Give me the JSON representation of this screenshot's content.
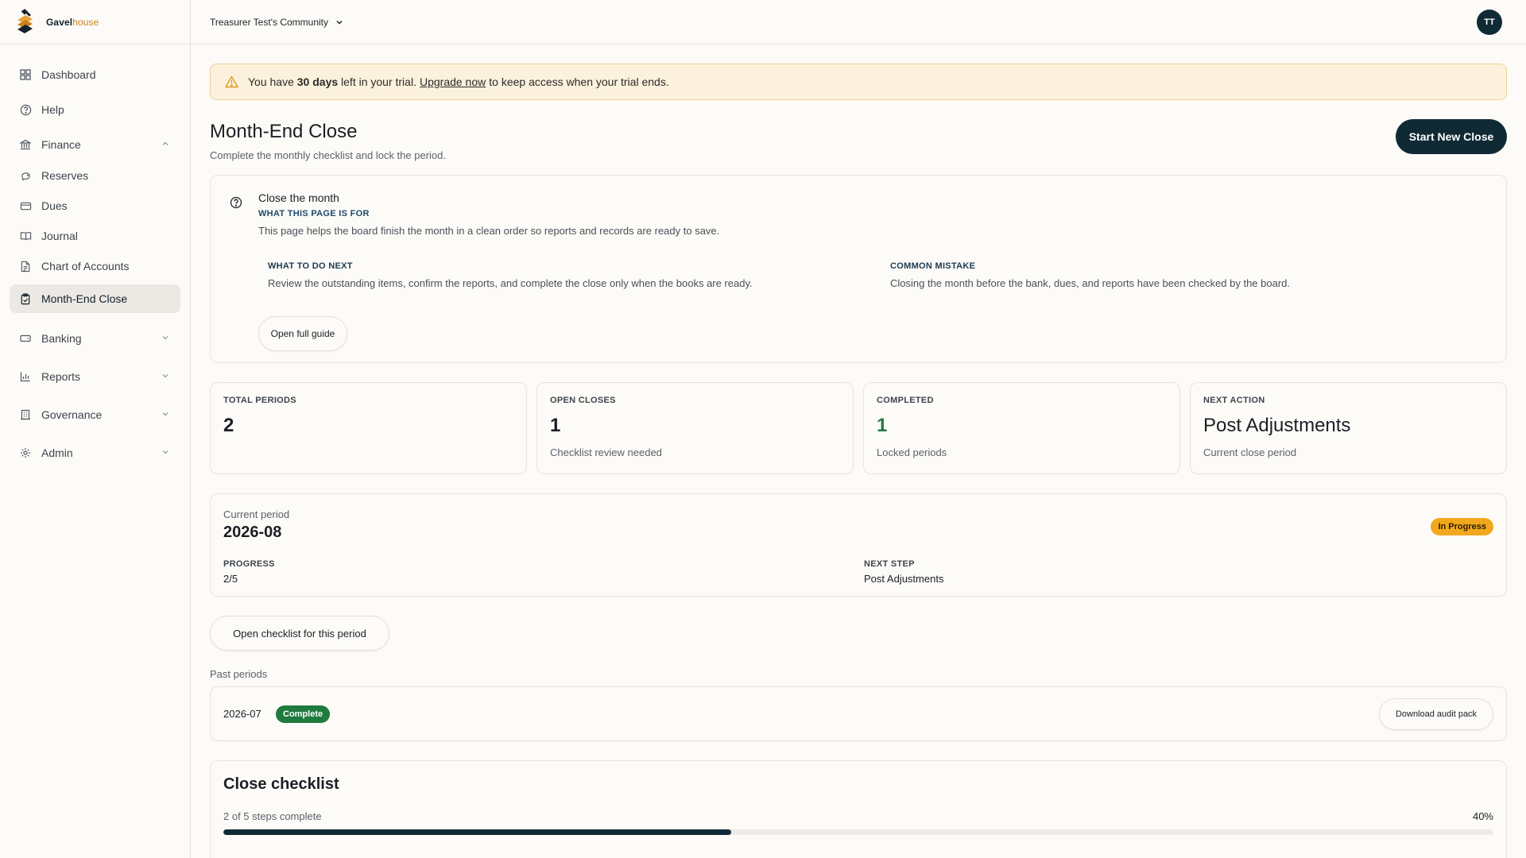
{
  "brand": {
    "part1": "Gavel",
    "part2": "house"
  },
  "sidebar": {
    "items": [
      {
        "label": "Dashboard"
      },
      {
        "label": "Help"
      },
      {
        "label": "Finance"
      },
      {
        "label": "Reserves"
      },
      {
        "label": "Dues"
      },
      {
        "label": "Journal"
      },
      {
        "label": "Chart of Accounts"
      },
      {
        "label": "Month-End Close"
      },
      {
        "label": "Banking"
      },
      {
        "label": "Reports"
      },
      {
        "label": "Governance"
      },
      {
        "label": "Admin"
      }
    ],
    "active": "Month-End Close"
  },
  "topbar": {
    "community": "Treasurer Test's Community",
    "avatar": "TT"
  },
  "trial": {
    "pre": "You have",
    "days": "30 days",
    "mid": "left in your trial.",
    "link": "Upgrade now",
    "post": "to keep access when your trial ends."
  },
  "page": {
    "title": "Month-End Close",
    "subtitle": "Complete the monthly checklist and lock the period.",
    "primary_button": "Start New Close"
  },
  "guide": {
    "title": "Close the month",
    "eyebrow": "WHAT THIS PAGE IS FOR",
    "description": "This page helps the board finish the month in a clean order so reports and records are ready to save.",
    "next_heading": "WHAT TO DO NEXT",
    "next_text": "Review the outstanding items, confirm the reports, and complete the close only when the books are ready.",
    "mistake_heading": "COMMON MISTAKE",
    "mistake_text": "Closing the month before the bank, dues, and reports have been checked by the board.",
    "button": "Open full guide"
  },
  "stats": [
    {
      "label": "TOTAL PERIODS",
      "value": "2",
      "note": ""
    },
    {
      "label": "OPEN CLOSES",
      "value": "1",
      "note": "Checklist review needed"
    },
    {
      "label": "COMPLETED",
      "value": "1",
      "note": "Locked periods"
    },
    {
      "label": "NEXT ACTION",
      "value": "Post Adjustments",
      "note": "Current close period"
    }
  ],
  "current_period": {
    "label": "Current period",
    "value": "2026-08",
    "status": "In Progress",
    "progress_label": "PROGRESS",
    "progress_value": "2/5",
    "next_step_label": "NEXT STEP",
    "next_step_value": "Post Adjustments"
  },
  "checklist_button": "Open checklist for this period",
  "past": {
    "title": "Past periods",
    "rows": [
      {
        "period": "2026-07",
        "status": "Complete",
        "action": "Download audit pack"
      }
    ]
  },
  "close_checklist": {
    "title": "Close checklist",
    "summary": "2 of 5 steps complete",
    "percent_label": "40%",
    "progress": 0.4
  },
  "colors": {
    "primary": "#0f2a35",
    "warning_bg": "#fcf1dc",
    "in_progress": "#f2a81c",
    "complete": "#1f7a3d"
  }
}
